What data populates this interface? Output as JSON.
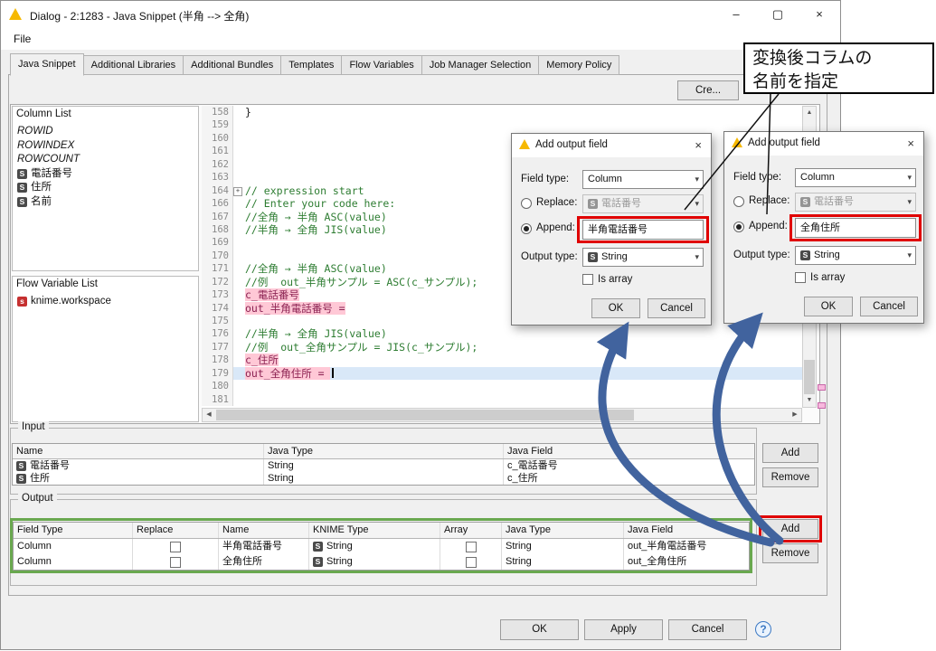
{
  "window": {
    "title": "Dialog - 2:1283 - Java Snippet (半角 --> 全角)"
  },
  "icons": {
    "minimize": "–",
    "maximize": "▢",
    "close": "×",
    "chevron_down": "▾",
    "arrow_up": "▲",
    "arrow_down": "▼",
    "arrow_left": "◀",
    "arrow_right": "▶",
    "fold_plus": "+",
    "help": "?"
  },
  "menu": {
    "items": [
      "File"
    ]
  },
  "tabs": [
    "Java Snippet",
    "Additional Libraries",
    "Additional Bundles",
    "Templates",
    "Flow Variables",
    "Job Manager Selection",
    "Memory Policy"
  ],
  "selected_tab": "Java Snippet",
  "create_button": "Cre...",
  "column_list": {
    "title": "Column List",
    "special": [
      "ROWID",
      "ROWINDEX",
      "ROWCOUNT"
    ],
    "columns": [
      {
        "icon": "S",
        "name": "電話番号"
      },
      {
        "icon": "S",
        "name": "住所"
      },
      {
        "icon": "S",
        "name": "名前"
      }
    ]
  },
  "flow_variables": {
    "title": "Flow Variable List",
    "items": [
      {
        "icon": "s",
        "name": "knime.workspace"
      }
    ]
  },
  "editor": {
    "fold_icon": "+",
    "lines": [
      {
        "n": "158",
        "t": "}",
        "cls": ""
      },
      {
        "n": "159",
        "t": "",
        "cls": ""
      },
      {
        "n": "160",
        "t": "",
        "cls": ""
      },
      {
        "n": "161",
        "t": "",
        "cls": ""
      },
      {
        "n": "162",
        "t": "",
        "cls": ""
      },
      {
        "n": "163",
        "t": "",
        "cls": ""
      },
      {
        "n": "164",
        "t": "// expression start",
        "cls": "c",
        "fold": true
      },
      {
        "n": "166",
        "t": "// Enter your code here:",
        "cls": "c"
      },
      {
        "n": "167",
        "t": "//全角 → 半角 ASC(value)",
        "cls": "c"
      },
      {
        "n": "168",
        "t": "//半角 → 全角 JIS(value)",
        "cls": "c"
      },
      {
        "n": "169",
        "t": "",
        "cls": ""
      },
      {
        "n": "170",
        "t": "",
        "cls": ""
      },
      {
        "n": "171",
        "t": "//全角 → 半角 ASC(value)",
        "cls": "c"
      },
      {
        "n": "172",
        "t": "//例  out_半角サンプル = ASC(c_サンプル);",
        "cls": "c"
      },
      {
        "n": "173",
        "t": "c_電話番号",
        "cls": "m"
      },
      {
        "n": "174",
        "t": "out_半角電話番号 =",
        "cls": "m"
      },
      {
        "n": "175",
        "t": "",
        "cls": ""
      },
      {
        "n": "176",
        "t": "//半角 → 全角 JIS(value)",
        "cls": "c"
      },
      {
        "n": "177",
        "t": "//例  out_全角サンプル = JIS(c_サンプル);",
        "cls": "c"
      },
      {
        "n": "178",
        "t": "c_住所",
        "cls": "m"
      },
      {
        "n": "179",
        "t": "out_全角住所 = ",
        "cls": "ms"
      },
      {
        "n": "180",
        "t": "",
        "cls": ""
      },
      {
        "n": "181",
        "t": "",
        "cls": ""
      }
    ]
  },
  "dialogs": [
    {
      "title": "Add output field",
      "field_type_label": "Field type:",
      "field_type_value": "Column",
      "replace_label": "Replace:",
      "replace_icon": "S",
      "replace_value": "電話番号",
      "append_label": "Append:",
      "append_value": "半角電話番号",
      "output_type_label": "Output type:",
      "output_type_icon": "S",
      "output_type_value": "String",
      "is_array_label": "Is array",
      "ok": "OK",
      "cancel": "Cancel"
    },
    {
      "title": "Add output field",
      "field_type_label": "Field type:",
      "field_type_value": "Column",
      "replace_label": "Replace:",
      "replace_icon": "S",
      "replace_value": "電話番号",
      "append_label": "Append:",
      "append_value": "全角住所",
      "output_type_label": "Output type:",
      "output_type_icon": "S",
      "output_type_value": "String",
      "is_array_label": "Is array",
      "ok": "OK",
      "cancel": "Cancel"
    }
  ],
  "annotation": {
    "line1": "変換後コラムの",
    "line2": "名前を指定"
  },
  "input": {
    "title": "Input",
    "headers": [
      "Name",
      "Java Type",
      "Java Field"
    ],
    "rows": [
      {
        "icon": "S",
        "name": "電話番号",
        "java_type": "String",
        "java_field": "c_電話番号"
      },
      {
        "icon": "S",
        "name": "住所",
        "java_type": "String",
        "java_field": "c_住所"
      }
    ],
    "add": "Add",
    "remove": "Remove"
  },
  "output": {
    "title": "Output",
    "headers": [
      "Field Type",
      "Replace",
      "Name",
      "KNIME Type",
      "Array",
      "Java Type",
      "Java Field"
    ],
    "rows": [
      {
        "field_type": "Column",
        "replace": false,
        "name": "半角電話番号",
        "knime_icon": "S",
        "knime_type": "String",
        "array": false,
        "java_type": "String",
        "java_field": "out_半角電話番号"
      },
      {
        "field_type": "Column",
        "replace": false,
        "name": "全角住所",
        "knime_icon": "S",
        "knime_type": "String",
        "array": false,
        "java_type": "String",
        "java_field": "out_全角住所"
      }
    ],
    "add": "Add",
    "remove": "Remove"
  },
  "footer": {
    "ok": "OK",
    "apply": "Apply",
    "cancel": "Cancel",
    "help": "?"
  },
  "colors": {
    "highlight_red": "#e00000",
    "highlight_green": "#69a84f",
    "arrow_blue": "#41639e"
  }
}
